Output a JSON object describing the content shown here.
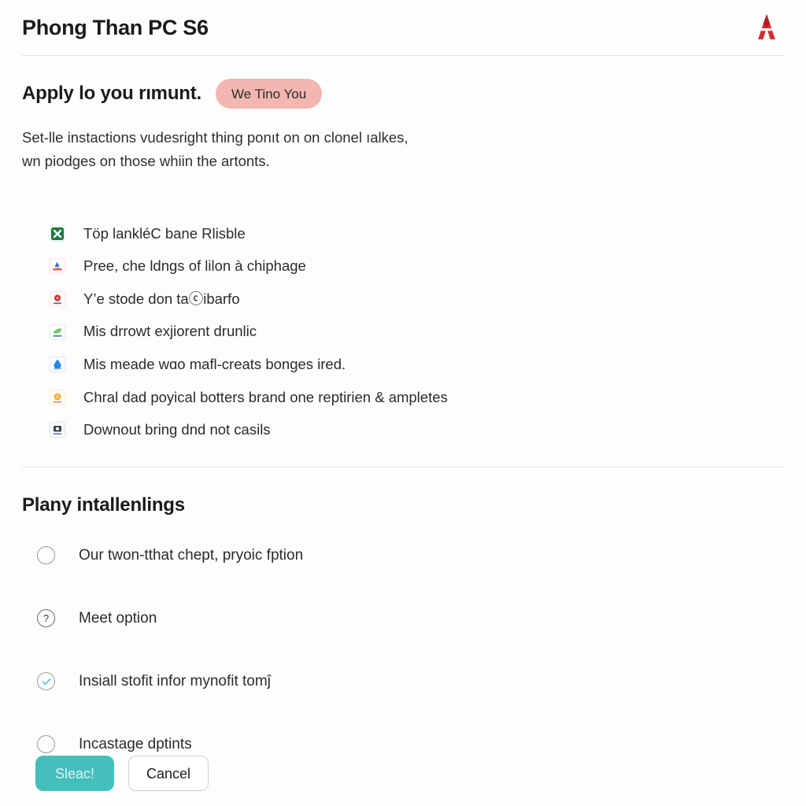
{
  "header": {
    "title": "Phong Than PC S6",
    "logo_icon": "brand-a-logo",
    "logo_color": "#d32f2f"
  },
  "apply_section": {
    "headline": "Apply lo you rımunt.",
    "badge": {
      "label": "We Tino You",
      "bg_color": "#f4b6b0",
      "text_color": "#2b2b2b"
    },
    "paragraph_line1": "Set-lle instactions vudesright thing ponıt on on clonel ıalkes,",
    "paragraph_line2": "wn piodges on those whiin the artonts."
  },
  "feature_list": [
    {
      "icon": "excel-spreadsheet-icon",
      "icon_color": "#1e7a42",
      "label": "Töp lankléC bane Rlisble"
    },
    {
      "icon": "powerpoint-slide-icon",
      "icon_color": "#c0392b",
      "label": "Pree, che ldngs of lilon à chiphage"
    },
    {
      "icon": "location-pin-icon",
      "icon_color": "#d32f2f",
      "label": "Y’e stode don taⓒibarfo"
    },
    {
      "icon": "green-leaf-icon",
      "icon_color": "#4caf50",
      "label": "Mis drrowt exjiorent drunlic"
    },
    {
      "icon": "water-droplet-icon",
      "icon_color": "#1e88e5",
      "label": "Mis meade wɑo mafl-creats bonges ired."
    },
    {
      "icon": "orange-coin-icon",
      "icon_color": "#f2a922",
      "label": "Chral dad poyical botters brand one reptirien & ampletes"
    },
    {
      "icon": "user-badge-icon",
      "icon_color": "#37474f",
      "label": "Downout bring dnd not casils"
    }
  ],
  "options_section": {
    "title": "Plany intallenlings",
    "items": [
      {
        "control": "radio-unselected-icon",
        "label": "Our twon-tthat chept, pryoic fption"
      },
      {
        "control": "help-question-icon",
        "label": "Meet option"
      },
      {
        "control": "check-circle-icon",
        "label": "Insiall stofit infor mynofit tomĵ"
      },
      {
        "control": "radio-unselected-icon",
        "label": "Incastage dptints"
      }
    ]
  },
  "buttons": {
    "primary_label": "Sleac!",
    "primary_bg": "#45bfbd",
    "primary_text_color": "#d9f5f4",
    "secondary_label": "Cancel"
  }
}
